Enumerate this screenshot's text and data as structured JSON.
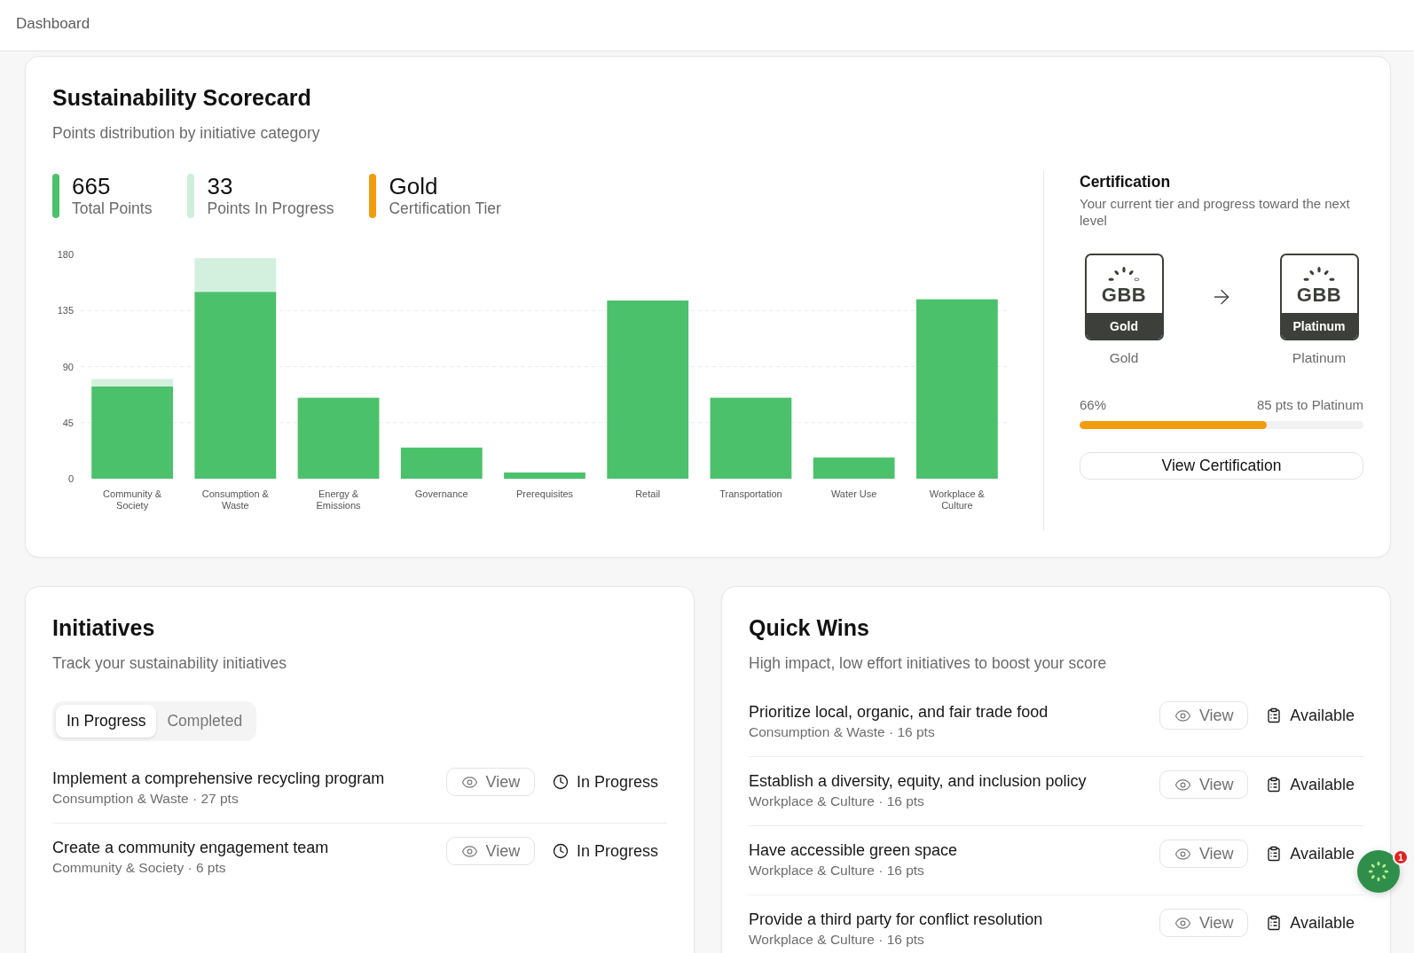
{
  "header": {
    "title": "Dashboard"
  },
  "scorecard": {
    "title": "Sustainability Scorecard",
    "subtitle": "Points distribution by initiative category",
    "stats": [
      {
        "value": "665",
        "label": "Total Points",
        "color": "#4cc16b"
      },
      {
        "value": "33",
        "label": "Points In Progress",
        "color": "#cdeedb"
      },
      {
        "value": "Gold",
        "label": "Certification Tier",
        "color": "#f09c0c"
      }
    ],
    "chart_data": {
      "type": "bar",
      "stacked": true,
      "grid": true,
      "categories": [
        "Community & Society",
        "Consumption & Waste",
        "Energy & Emissions",
        "Governance",
        "Prerequisites",
        "Retail",
        "Transportation",
        "Water Use",
        "Workplace & Culture"
      ],
      "series": [
        {
          "color": "#4cc16b",
          "values": [
            74,
            150,
            65,
            25,
            5,
            143,
            65,
            17,
            144
          ]
        },
        {
          "color": "#d3f0df",
          "values": [
            6,
            27,
            0,
            0,
            0,
            0,
            0,
            0,
            0
          ]
        }
      ],
      "ylim": [
        0,
        180
      ],
      "yticks": [
        0,
        45,
        90,
        135,
        180
      ]
    }
  },
  "certification": {
    "title": "Certification",
    "description": "Your current tier and progress toward the next level",
    "badges": [
      {
        "logo_text": "GBB",
        "band": "Gold",
        "caption": "Gold",
        "leaves": [
          {
            "filled": true
          },
          {
            "filled": true
          },
          {
            "filled": true
          },
          {
            "filled": true
          },
          {
            "filled": false
          }
        ]
      },
      {
        "logo_text": "GBB",
        "band": "Platinum",
        "caption": "Platinum",
        "leaves": [
          {
            "filled": true
          },
          {
            "filled": true
          },
          {
            "filled": true
          },
          {
            "filled": true
          },
          {
            "filled": true
          }
        ]
      }
    ],
    "progress": {
      "percent": "66%",
      "remaining": "85 pts to Platinum",
      "level": 0.66
    },
    "button": "View Certification"
  },
  "initiatives": {
    "title": "Initiatives",
    "subtitle": "Track your sustainability initiatives",
    "tabs": [
      {
        "label": "In Progress",
        "selected": true
      },
      {
        "label": "Completed",
        "selected": false
      }
    ],
    "items": [
      {
        "title": "Implement a comprehensive recycling program",
        "meta": "Consumption & Waste · 27 pts",
        "action": "View",
        "status": "In Progress",
        "kind": "in_progress"
      },
      {
        "title": "Create a community engagement team",
        "meta": "Community & Society · 6 pts",
        "action": "View",
        "status": "In Progress",
        "kind": "in_progress"
      }
    ]
  },
  "quick_wins": {
    "title": "Quick Wins",
    "subtitle": "High impact, low effort initiatives to boost your score",
    "items": [
      {
        "title": "Prioritize local, organic, and fair trade food",
        "meta": "Consumption & Waste · 16 pts",
        "action": "View",
        "status": "Available",
        "kind": "available"
      },
      {
        "title": "Establish a diversity, equity, and inclusion policy",
        "meta": "Workplace & Culture · 16 pts",
        "action": "View",
        "status": "Available",
        "kind": "available"
      },
      {
        "title": "Have accessible green space",
        "meta": "Workplace & Culture · 16 pts",
        "action": "View",
        "status": "Available",
        "kind": "available"
      },
      {
        "title": "Provide a third party for conflict resolution",
        "meta": "Workplace & Culture · 16 pts",
        "action": "View",
        "status": "Available",
        "kind": "available"
      }
    ]
  },
  "assistant": {
    "badge": "1"
  }
}
